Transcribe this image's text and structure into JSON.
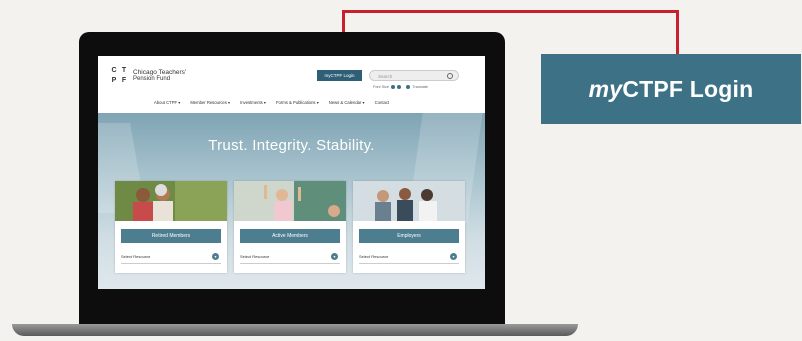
{
  "callout": {
    "label_prefix": "my",
    "label_rest": "CTPF Login"
  },
  "site": {
    "logo_letters": [
      "C",
      "T",
      "P",
      "F"
    ],
    "logo_line1": "Chicago Teachers'",
    "logo_line2": "Pension Fund",
    "login_button": "myCTPF Login",
    "search_placeholder": "Search",
    "utility_text": "Font Size",
    "translate_text": "Translate",
    "nav": [
      {
        "label": "About CTPF ▾"
      },
      {
        "label": "Member Resources ▾"
      },
      {
        "label": "Investments ▾"
      },
      {
        "label": "Forms & Publications ▾"
      },
      {
        "label": "News & Calendar ▾"
      },
      {
        "label": "Contact"
      }
    ],
    "tagline": "Trust. Integrity. Stability.",
    "cards": [
      {
        "button": "Retired Members",
        "select": "Select Resource"
      },
      {
        "button": "Active Members",
        "select": "Select Resource"
      },
      {
        "button": "Employers",
        "select": "Select Resource"
      }
    ]
  },
  "colors": {
    "callout": "#c8202f",
    "login_box": "#3d7186",
    "card_button": "#4d7e90"
  }
}
